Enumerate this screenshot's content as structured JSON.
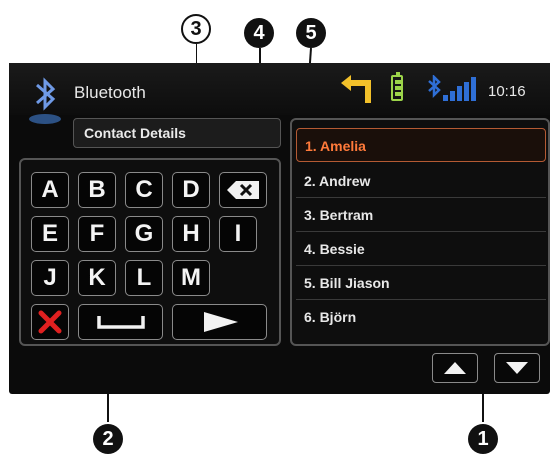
{
  "callouts": {
    "c1": "1",
    "c2": "2",
    "c3": "3",
    "c4": "4",
    "c5": "5"
  },
  "header": {
    "title": "Bluetooth",
    "time": "10:16"
  },
  "field": {
    "label": "Contact Details"
  },
  "keypad": {
    "row1": [
      "A",
      "B",
      "C",
      "D"
    ],
    "row2": [
      "E",
      "F",
      "G",
      "H",
      "I"
    ],
    "row3": [
      "J",
      "K",
      "L",
      "M"
    ],
    "icons": {
      "backspace": "backspace-icon",
      "cancel": "cancel-icon",
      "space": "space-icon",
      "enter": "enter-arrow-icon"
    }
  },
  "contacts": [
    {
      "label": "1. Amelia"
    },
    {
      "label": "2. Andrew"
    },
    {
      "label": "3. Bertram"
    },
    {
      "label": "4. Bessie"
    },
    {
      "label": "5. Bill Jiason"
    },
    {
      "label": "6. Björn"
    }
  ],
  "colors": {
    "accent": "#ff7a3a",
    "bluetooth": "#2f6fd6",
    "battery": "#9cd44a",
    "nav": "#f2c02a",
    "cancel": "#e02020"
  }
}
